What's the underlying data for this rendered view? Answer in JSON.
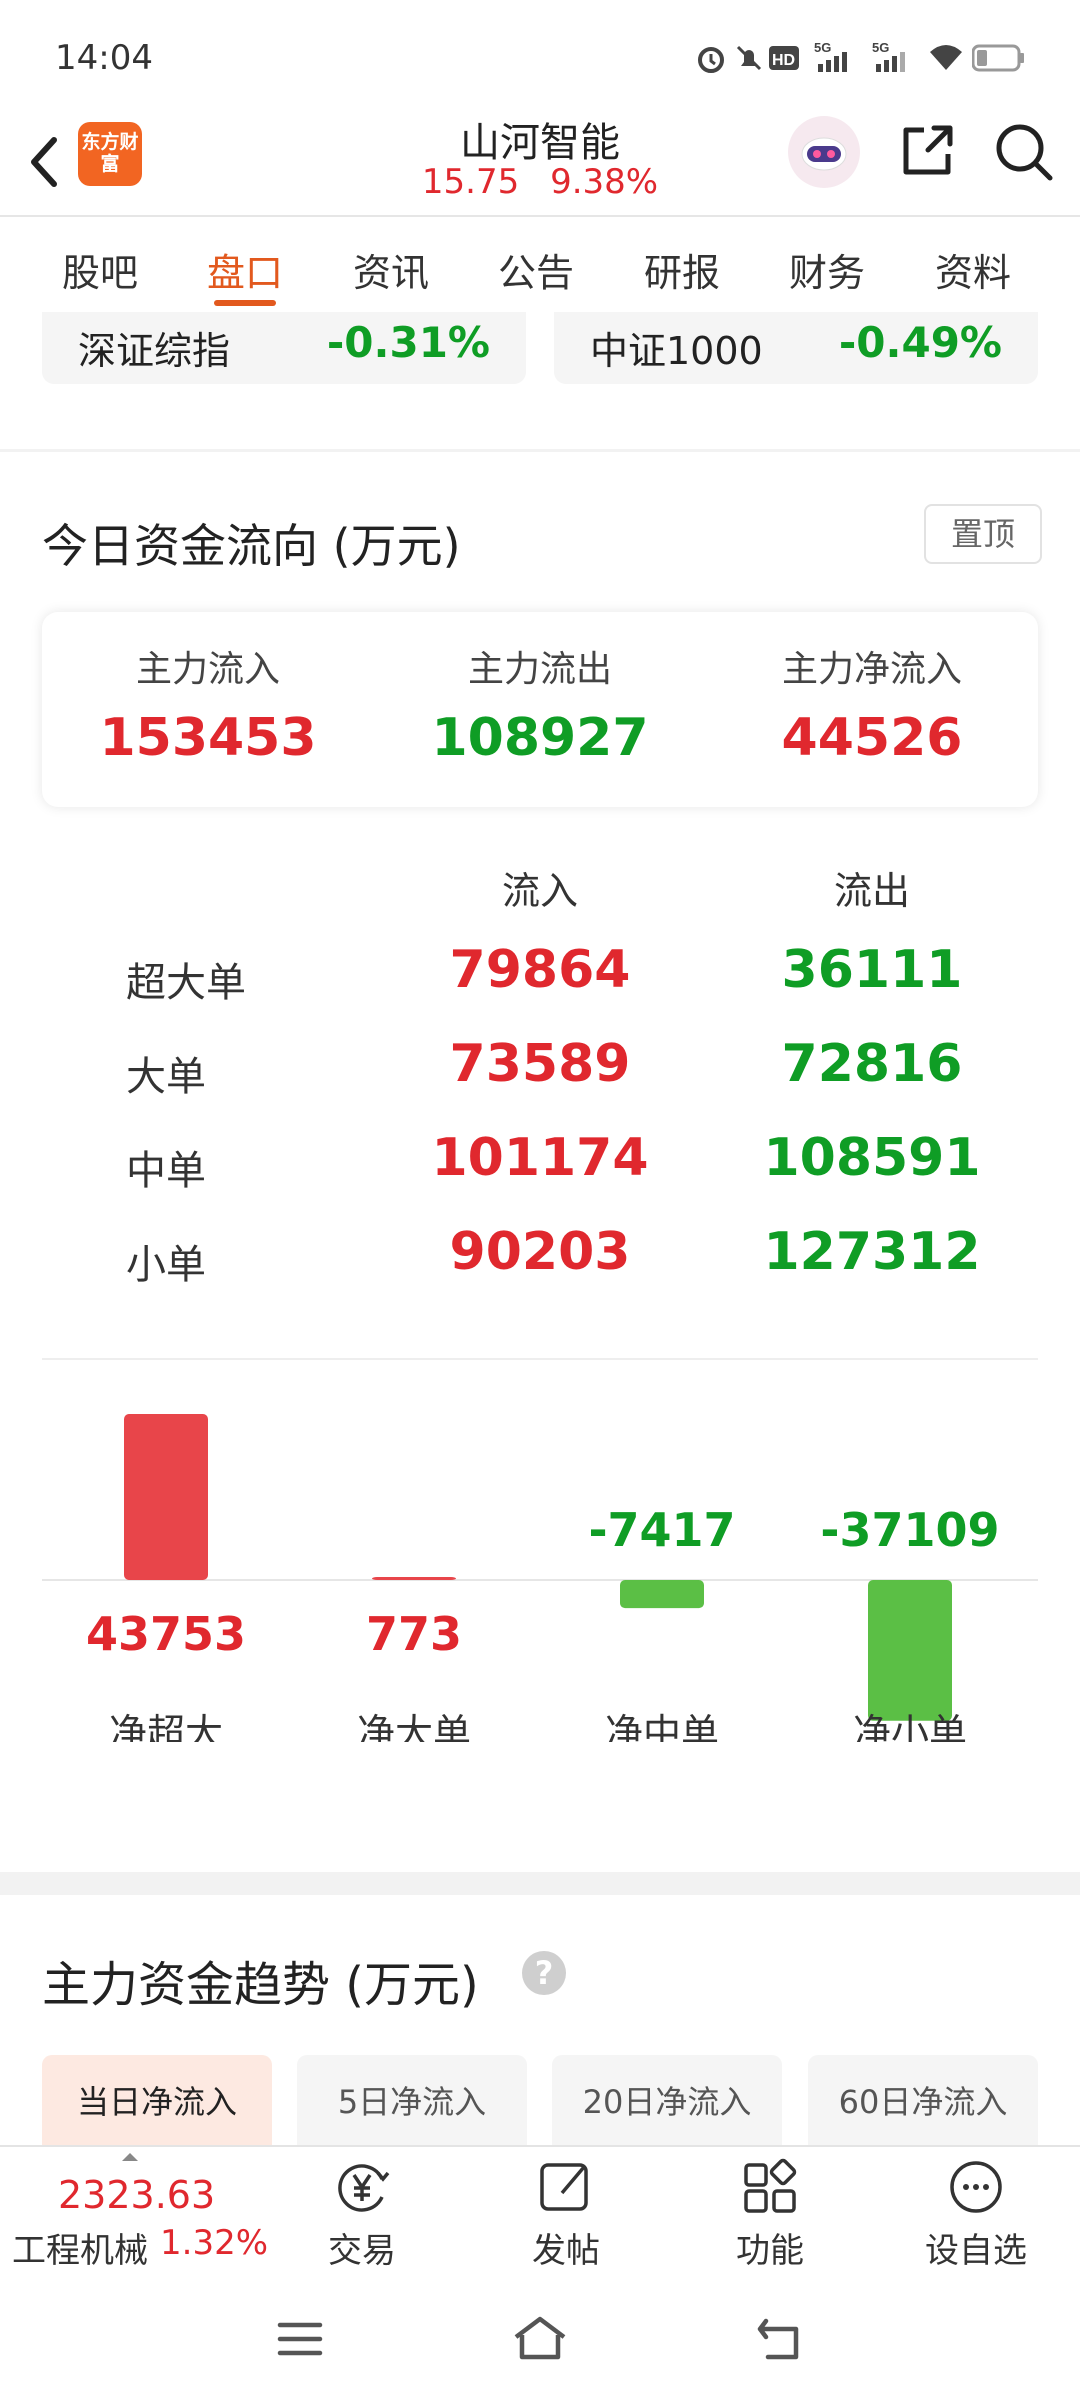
{
  "status_bar": {
    "time": "14:04",
    "icons": [
      "alarm-icon",
      "mute-bell-icon",
      "hd-icon",
      "signal-5g-icon",
      "signal-5g-icon",
      "wifi-icon",
      "battery-icon"
    ]
  },
  "header": {
    "logo_text": "东方财富",
    "stock_name": "山河智能",
    "price": "15.75",
    "change_pct": "9.38%"
  },
  "tabs": [
    {
      "label": "股吧",
      "active": false
    },
    {
      "label": "盘口",
      "active": true
    },
    {
      "label": "资讯",
      "active": false
    },
    {
      "label": "公告",
      "active": false
    },
    {
      "label": "研报",
      "active": false
    },
    {
      "label": "财务",
      "active": false
    },
    {
      "label": "资料",
      "active": false
    }
  ],
  "indices": [
    {
      "name": "深证综指",
      "value": "-0.31%"
    },
    {
      "name": "中证1000",
      "value": "-0.49%"
    }
  ],
  "fund_flow": {
    "title": "今日资金流向 (万元)",
    "pin_label": "置顶",
    "summary": [
      {
        "label": "主力流入",
        "value": "153453"
      },
      {
        "label": "主力流出",
        "value": "108927"
      },
      {
        "label": "主力净流入",
        "value": "44526"
      }
    ],
    "table": {
      "headers": [
        "流入",
        "流出"
      ],
      "rows": [
        {
          "label": "超大单",
          "inflow": "79864",
          "outflow": "36111"
        },
        {
          "label": "大单",
          "inflow": "73589",
          "outflow": "72816"
        },
        {
          "label": "中单",
          "inflow": "101174",
          "outflow": "108591"
        },
        {
          "label": "小单",
          "inflow": "90203",
          "outflow": "127312"
        }
      ]
    }
  },
  "chart_data": {
    "type": "bar",
    "categories": [
      "净超大",
      "净大单",
      "净中单",
      "净小单"
    ],
    "values": [
      43753,
      773,
      -7417,
      -37109
    ],
    "labels": [
      "43753",
      "773",
      "-7417",
      "-37109"
    ],
    "colors": {
      "positive": "#e8454a",
      "negative": "#5bbf45"
    }
  },
  "trend": {
    "title": "主力资金趋势 (万元)",
    "help": "?",
    "tabs": [
      {
        "label": "当日净流入",
        "active": true
      },
      {
        "label": "5日净流入",
        "active": false
      },
      {
        "label": "20日净流入",
        "active": false
      },
      {
        "label": "60日净流入",
        "active": false
      }
    ]
  },
  "bottom_bar": {
    "index_price": "2323.63",
    "index_name": "工程机械",
    "index_pct": "1.32%",
    "items": [
      {
        "label": "交易",
        "icon": "trade-yen-icon"
      },
      {
        "label": "发帖",
        "icon": "compose-icon"
      },
      {
        "label": "功能",
        "icon": "apps-grid-icon"
      },
      {
        "label": "设自选",
        "icon": "more-dots-icon"
      }
    ]
  },
  "colors": {
    "accent": "#e2591e",
    "up": "#e0282e",
    "down": "#0f9d25"
  }
}
